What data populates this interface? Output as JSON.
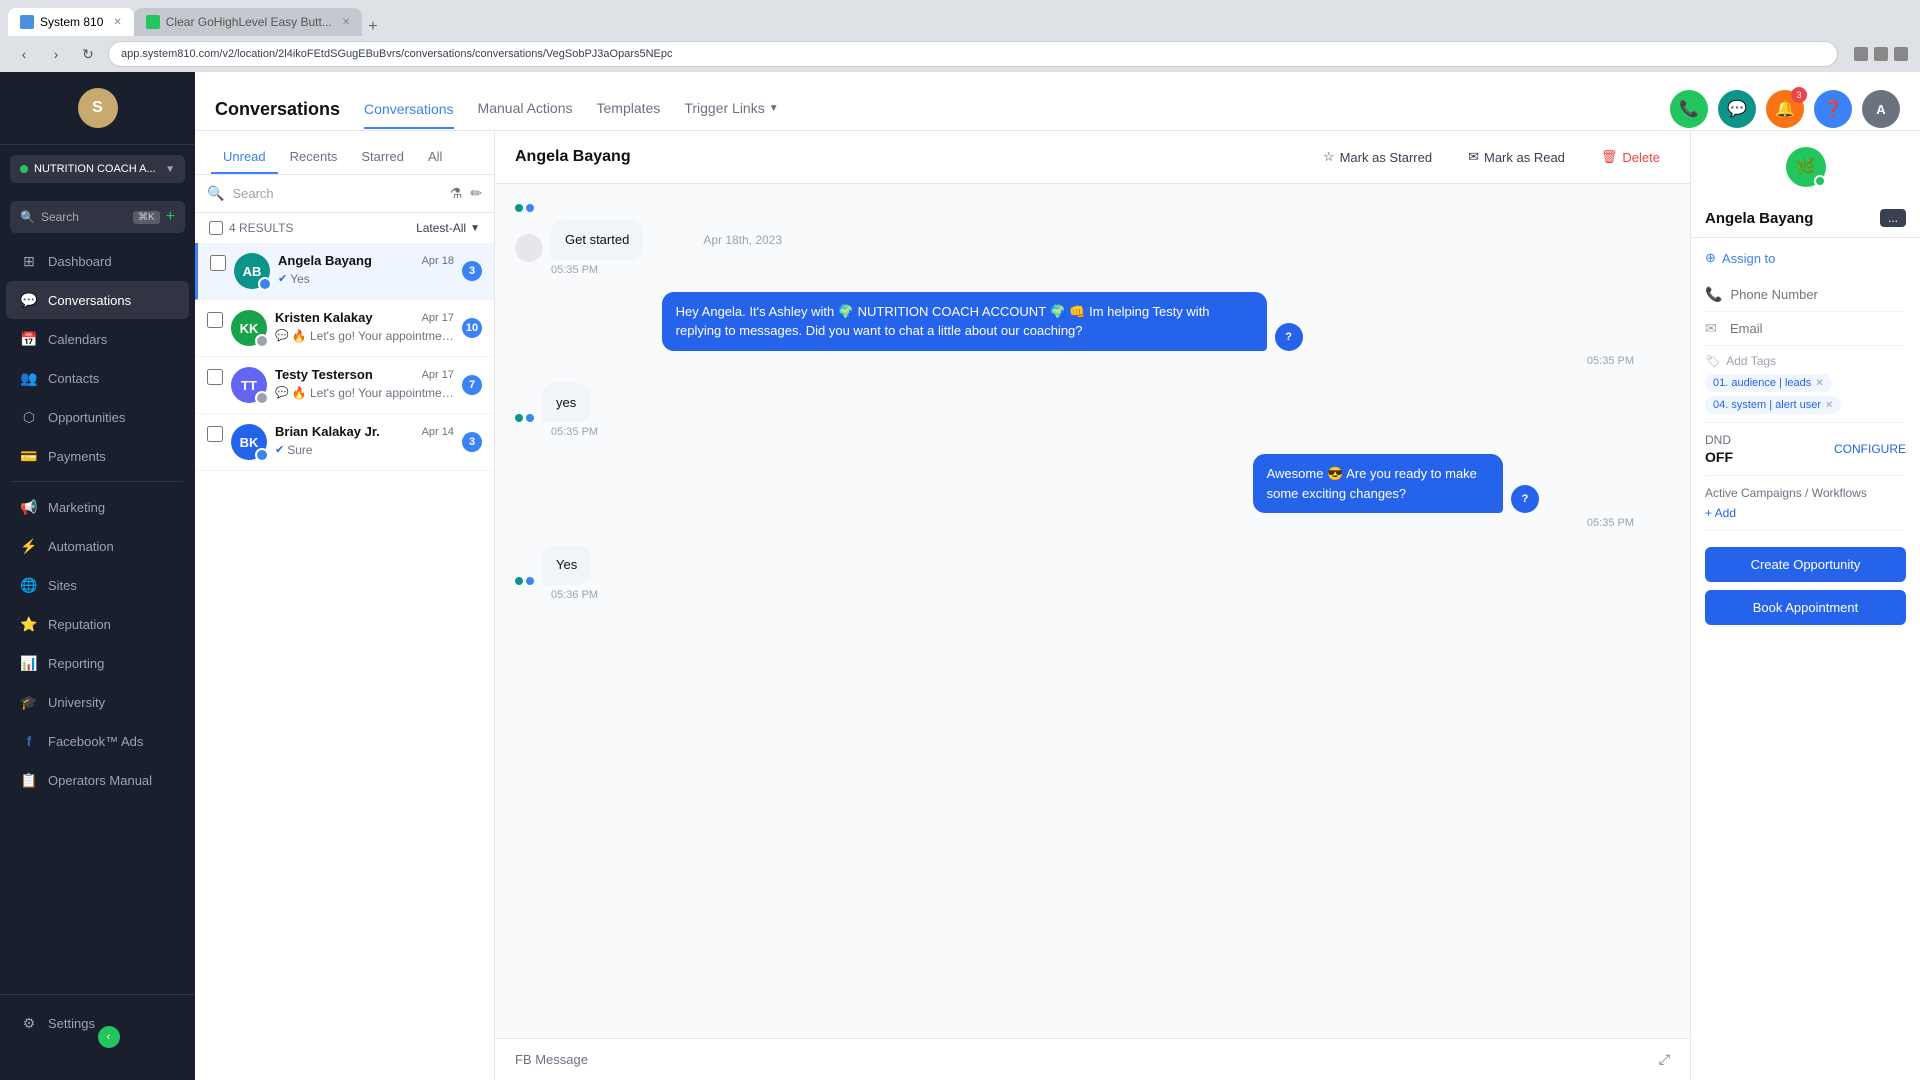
{
  "browser": {
    "tab1_label": "System 810",
    "tab2_label": "Clear GoHighLevel Easy Butt...",
    "address": "app.system810.com/v2/location/2l4ikoFEtdSGugEBuBvrs/conversations/conversations/VegSobPJ3aOpars5NEpc"
  },
  "header": {
    "phone_icon": "📞",
    "chat_icon": "💬",
    "bell_icon": "🔔",
    "help_icon": "❓",
    "avatar_initials": "A"
  },
  "sidebar": {
    "logo_text": "S",
    "account_name": "NUTRITION COACH A...",
    "search_placeholder": "Search",
    "search_kbd": "⌘K",
    "items": [
      {
        "id": "dashboard",
        "label": "Dashboard",
        "icon": "⊞"
      },
      {
        "id": "conversations",
        "label": "Conversations",
        "icon": "💬",
        "active": true
      },
      {
        "id": "calendars",
        "label": "Calendars",
        "icon": "📅"
      },
      {
        "id": "contacts",
        "label": "Contacts",
        "icon": "👥"
      },
      {
        "id": "opportunities",
        "label": "Opportunities",
        "icon": "⬡"
      },
      {
        "id": "payments",
        "label": "Payments",
        "icon": "💳"
      },
      {
        "id": "marketing",
        "label": "Marketing",
        "icon": "📢"
      },
      {
        "id": "automation",
        "label": "Automation",
        "icon": "⚡"
      },
      {
        "id": "sites",
        "label": "Sites",
        "icon": "🌐"
      },
      {
        "id": "reputation",
        "label": "Reputation",
        "icon": "⭐"
      },
      {
        "id": "reporting",
        "label": "Reporting",
        "icon": "📊"
      },
      {
        "id": "university",
        "label": "University",
        "icon": "🎓"
      },
      {
        "id": "facebook_ads",
        "label": "Facebook™ Ads",
        "icon": "f"
      },
      {
        "id": "operators_manual",
        "label": "Operators Manual",
        "icon": "📋"
      }
    ],
    "settings_label": "Settings",
    "settings_icon": "⚙"
  },
  "conversations": {
    "page_title": "Conversations",
    "nav_items": [
      {
        "id": "conversations",
        "label": "Conversations",
        "active": true
      },
      {
        "id": "manual_actions",
        "label": "Manual Actions"
      },
      {
        "id": "templates",
        "label": "Templates"
      },
      {
        "id": "trigger_links",
        "label": "Trigger Links",
        "has_dropdown": true
      }
    ],
    "tabs": [
      {
        "id": "unread",
        "label": "Unread",
        "active": true
      },
      {
        "id": "recents",
        "label": "Recents"
      },
      {
        "id": "starred",
        "label": "Starred"
      },
      {
        "id": "all",
        "label": "All"
      }
    ],
    "search_placeholder": "Search",
    "results_count": "4 RESULTS",
    "filter_label": "Latest-All",
    "conversations": [
      {
        "id": "angela",
        "name": "Angela Bayang",
        "date": "Apr 18",
        "preview": "Yes",
        "unread": 3,
        "avatar_initials": "AB",
        "avatar_color": "teal",
        "selected": true,
        "platform": "messenger"
      },
      {
        "id": "kristen",
        "name": "Kristen Kalakay",
        "date": "Apr 17",
        "preview": "🔥 Let's go! Your appointment is star...",
        "unread": 10,
        "avatar_initials": "KK",
        "avatar_color": "green",
        "selected": false,
        "platform": "messenger"
      },
      {
        "id": "testy",
        "name": "Testy Testerson",
        "date": "Apr 17",
        "preview": "🔥 Let's go! Your appointment is star...",
        "unread": 7,
        "avatar_initials": "TT",
        "avatar_color": "indigo",
        "selected": false,
        "platform": "chat"
      },
      {
        "id": "brian",
        "name": "Brian Kalakay Jr.",
        "date": "Apr 14",
        "preview": "Sure",
        "unread": 3,
        "avatar_initials": "BK",
        "avatar_color": "blue",
        "selected": false,
        "platform": "messenger"
      }
    ]
  },
  "chat": {
    "contact_name": "Angela Bayang",
    "actions": {
      "star_label": "Mark as Starred",
      "read_label": "Mark as Read",
      "delete_label": "Delete"
    },
    "messages": [
      {
        "id": "msg1",
        "type": "incoming",
        "text": "Get started",
        "time": "05:35 PM",
        "date": "Apr 18th, 2023",
        "show_date": true
      },
      {
        "id": "msg2",
        "type": "outgoing",
        "text": "Hey Angela. It's Ashley with 🌍 NUTRITION COACH ACCOUNT 🌍 👊 Im helping Testy with replying to messages. Did you want to chat a little about our coaching?",
        "time": "05:35 PM",
        "show_date": false
      },
      {
        "id": "msg3",
        "type": "incoming",
        "text": "yes",
        "time": "05:35 PM",
        "show_date": false
      },
      {
        "id": "msg4",
        "type": "outgoing",
        "text": "Awesome 😎 Are you ready to make some exciting changes?",
        "time": "05:35 PM",
        "show_date": false
      },
      {
        "id": "msg5",
        "type": "incoming",
        "text": "Yes",
        "time": "05:36 PM",
        "show_date": false
      }
    ],
    "footer_label": "FB Message",
    "footer_expand_icon": "⤢"
  },
  "right_sidebar": {
    "contact_name": "Angela Bayang",
    "more_label": "...",
    "assign_label": "Assign to",
    "phone_placeholder": "Phone Number",
    "email_placeholder": "",
    "tags_label": "Add Tags",
    "tags": [
      {
        "id": "tag1",
        "label": "01. audience | leads"
      },
      {
        "id": "tag2",
        "label": "04. system | alert user"
      }
    ],
    "dnd_label": "DND",
    "dnd_value": "OFF",
    "configure_label": "CONFIGURE",
    "campaigns_label": "Active Campaigns / Workflows",
    "add_label": "+ Add",
    "create_opportunity_label": "Create Opportunity",
    "book_appointment_label": "Book Appointment"
  }
}
